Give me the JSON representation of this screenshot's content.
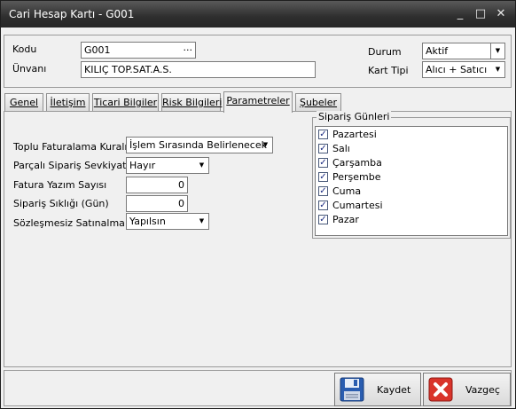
{
  "window": {
    "title": "Cari Hesap Kartı - G001",
    "minimize": "_",
    "maximize": "□",
    "close": "✕"
  },
  "header": {
    "kodu_label": "Kodu",
    "kodu_value": "G001",
    "kodu_button": "···",
    "unvani_label": "Ünvanı",
    "unvani_value": "KILIÇ TOP.SAT.A.S.",
    "durum_label": "Durum",
    "durum_value": "Aktif",
    "kart_tipi_label": "Kart Tipi",
    "kart_tipi_value": "Alıcı + Satıcı"
  },
  "tabs": [
    "Genel",
    "İletişim",
    "Ticari Bilgiler",
    "Risk Bilgileri",
    "Parametreler",
    "Şubeler"
  ],
  "active_tab": "Parametreler",
  "params": {
    "toplu_label": "Toplu Faturalama Kuralı",
    "toplu_value": "İşlem Sırasında Belirlenecek",
    "parcali_label": "Parçalı Sipariş Sevkiyatı",
    "parcali_value": "Hayır",
    "fatura_label": "Fatura Yazım Sayısı",
    "fatura_value": "0",
    "siparis_label": "Sipariş Sıklığı (Gün)",
    "siparis_value": "0",
    "sozlesme_label": "Sözleşmesiz Satınalma",
    "sozlesme_value": "Yapılsın"
  },
  "siparis_gunleri": {
    "title": "Sipariş Günleri",
    "days": [
      {
        "label": "Pazartesi",
        "checked": true
      },
      {
        "label": "Salı",
        "checked": true
      },
      {
        "label": "Çarşamba",
        "checked": true
      },
      {
        "label": "Perşembe",
        "checked": true
      },
      {
        "label": "Cuma",
        "checked": true
      },
      {
        "label": "Cumartesi",
        "checked": true
      },
      {
        "label": "Pazar",
        "checked": true
      }
    ]
  },
  "buttons": {
    "save": "Kaydet",
    "cancel": "Vazgeç"
  },
  "colors": {
    "titlebar": "#2e2e2e",
    "save_icon": "#2a5db0",
    "cancel_icon": "#d9342b",
    "checkmark": "#1a2a80"
  }
}
